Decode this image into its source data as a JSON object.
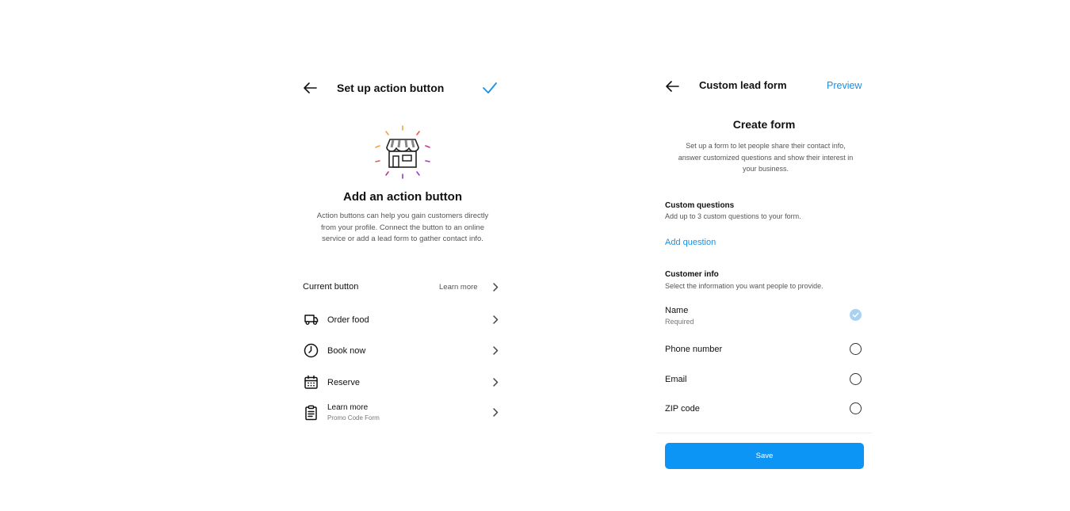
{
  "setup": {
    "title": "Set up action button",
    "heading": "Add an action button",
    "description": "Action buttons can help you gain customers directly from your profile. Connect the button to an online service or add a lead form to gather contact info.",
    "current_button_label": "Current button",
    "learn_more_label": "Learn more",
    "options": [
      {
        "label": "Order food",
        "icon": "truck-icon"
      },
      {
        "label": "Book now",
        "icon": "clock-icon"
      },
      {
        "label": "Reserve",
        "icon": "calendar-icon"
      },
      {
        "label": "Learn more",
        "sublabel": "Promo Code Form",
        "icon": "clipboard-icon"
      }
    ]
  },
  "lead_form": {
    "title": "Custom lead form",
    "preview_label": "Preview",
    "heading": "Create form",
    "description": "Set up a form to let people share their contact info, answer customized questions and show their interest in your business.",
    "custom_questions": {
      "title": "Custom questions",
      "subtitle": "Add up to 3 custom questions to your form.",
      "add_label": "Add question"
    },
    "customer_info": {
      "title": "Customer info",
      "subtitle": "Select the information you want people to provide.",
      "fields": [
        {
          "label": "Name",
          "sublabel": "Required",
          "selected": true
        },
        {
          "label": "Phone number",
          "selected": false
        },
        {
          "label": "Email",
          "selected": false
        },
        {
          "label": "ZIP code",
          "selected": false
        }
      ]
    },
    "save_label": "Save"
  },
  "colors": {
    "accent": "#0d95f6",
    "link": "#1a8fe3",
    "selected_radio": "#a9d2f2"
  }
}
